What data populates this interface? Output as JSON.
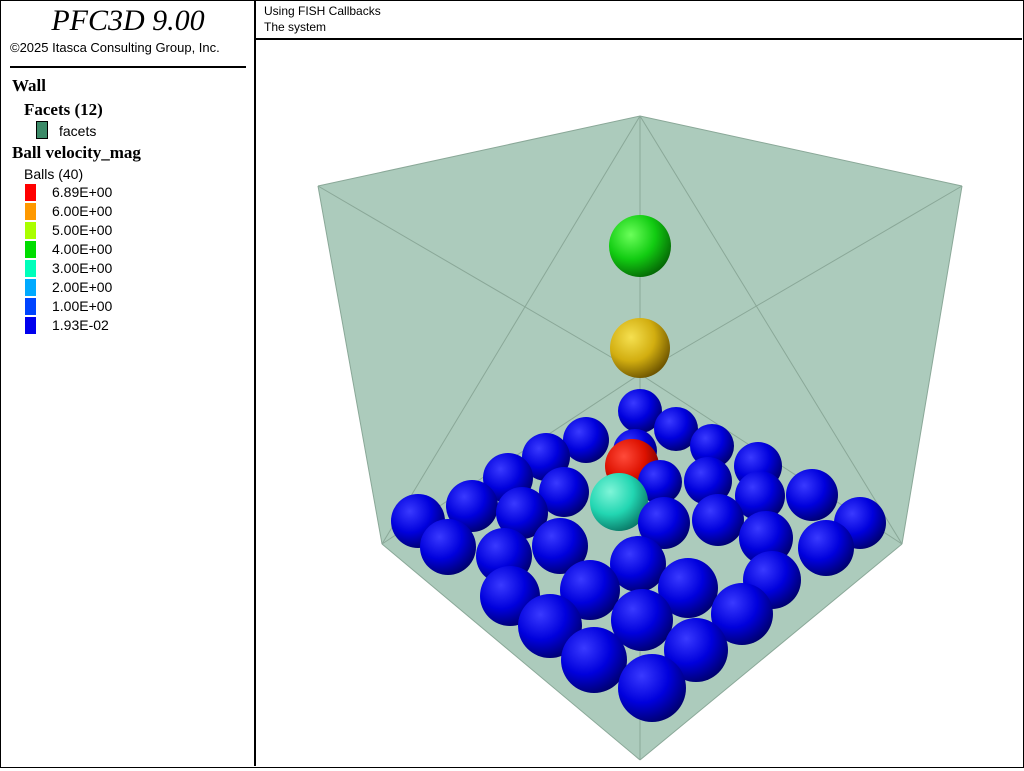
{
  "app": {
    "title": "PFC3D 9.00",
    "copyright": "©2025 Itasca Consulting Group, Inc."
  },
  "header": {
    "line1": "Using FISH Callbacks",
    "line2": "The system"
  },
  "legend": {
    "wall_heading": "Wall",
    "facets_heading": "Facets (12)",
    "facets_label": "facets",
    "facets_color": "#3c8a68",
    "ball_heading": "Ball velocity_mag",
    "balls_label": "Balls (40)",
    "entries": [
      {
        "label": "6.89E+00",
        "color": "#ff0000"
      },
      {
        "label": "6.00E+00",
        "color": "#ff9900"
      },
      {
        "label": "5.00E+00",
        "color": "#aaff00"
      },
      {
        "label": "4.00E+00",
        "color": "#00dd00"
      },
      {
        "label": "3.00E+00",
        "color": "#00ffbb"
      },
      {
        "label": "2.00E+00",
        "color": "#00aaff"
      },
      {
        "label": "1.00E+00",
        "color": "#0044ff"
      },
      {
        "label": "1.93E-02",
        "color": "#0000ee"
      }
    ]
  },
  "scene": {
    "box_fill_color": "#a8c8b8",
    "box_edge_color": "#8aa898",
    "ball_count": 40
  }
}
